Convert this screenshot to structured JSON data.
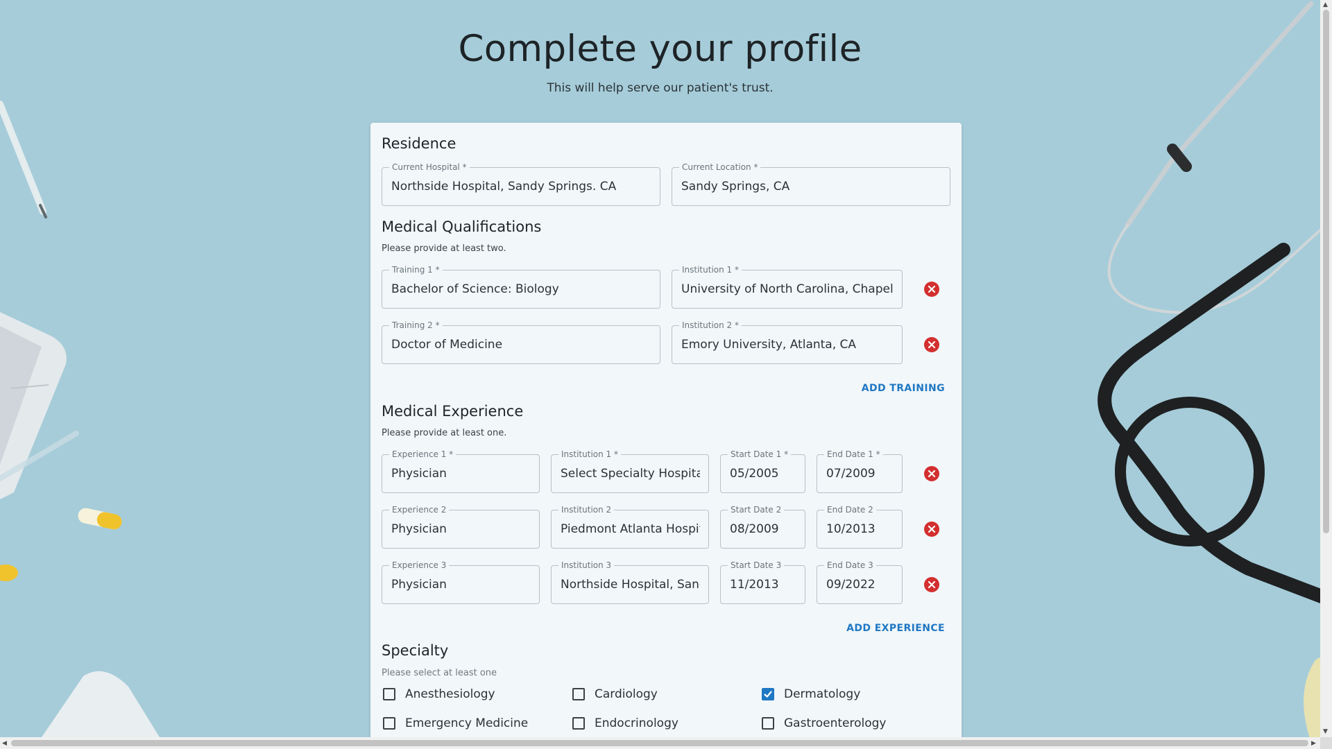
{
  "page": {
    "title": "Complete your profile",
    "subtitle": "This will help serve our patient's trust."
  },
  "residence": {
    "title": "Residence",
    "current_hospital_label": "Current Hospital *",
    "current_hospital_value": "Northside Hospital, Sandy Springs. CA",
    "current_location_label": "Current Location *",
    "current_location_value": "Sandy Springs, CA"
  },
  "qualifications": {
    "title": "Medical Qualifications",
    "note": "Please provide at least two.",
    "rows": [
      {
        "training_label": "Training 1 *",
        "training_value": "Bachelor of Science: Biology",
        "institution_label": "Institution 1 *",
        "institution_value": "University of North Carolina, Chapel Hill"
      },
      {
        "training_label": "Training 2 *",
        "training_value": "Doctor of Medicine",
        "institution_label": "Institution 2 *",
        "institution_value": "Emory University, Atlanta, CA"
      }
    ],
    "add_label": "ADD TRAINING"
  },
  "experience": {
    "title": "Medical Experience",
    "note": "Please provide at least one.",
    "rows": [
      {
        "exp_label": "Experience 1 *",
        "exp_value": "Physician",
        "inst_label": "Institution 1 *",
        "inst_value": "Select Specialty Hospital",
        "start_label": "Start Date 1 *",
        "start_value": "05/2005",
        "end_label": "End Date 1 *",
        "end_value": "07/2009"
      },
      {
        "exp_label": "Experience 2",
        "exp_value": "Physician",
        "inst_label": "Institution 2",
        "inst_value": "Piedmont Atlanta Hospital",
        "start_label": "Start Date 2",
        "start_value": "08/2009",
        "end_label": "End Date 2",
        "end_value": "10/2013"
      },
      {
        "exp_label": "Experience 3",
        "exp_value": "Physician",
        "inst_label": "Institution 3",
        "inst_value": "Northside Hospital, Sandy Springs",
        "start_label": "Start Date 3",
        "start_value": "11/2013",
        "end_label": "End Date 3",
        "end_value": "09/2022"
      }
    ],
    "add_label": "ADD EXPERIENCE"
  },
  "specialty": {
    "title": "Specialty",
    "note": "Please select at least one",
    "options": [
      {
        "label": "Anesthesiology",
        "checked": false
      },
      {
        "label": "Cardiology",
        "checked": false
      },
      {
        "label": "Dermatology",
        "checked": true
      },
      {
        "label": "Emergency Medicine",
        "checked": false
      },
      {
        "label": "Endocrinology",
        "checked": false
      },
      {
        "label": "Gastroenterology",
        "checked": false
      }
    ]
  },
  "colors": {
    "background": "#a6ccd9",
    "card": "#f2f7fa",
    "accent": "#1f78c4",
    "danger": "#d32f2f"
  },
  "icons": {
    "remove": "close-circle-icon",
    "check": "check-icon"
  }
}
